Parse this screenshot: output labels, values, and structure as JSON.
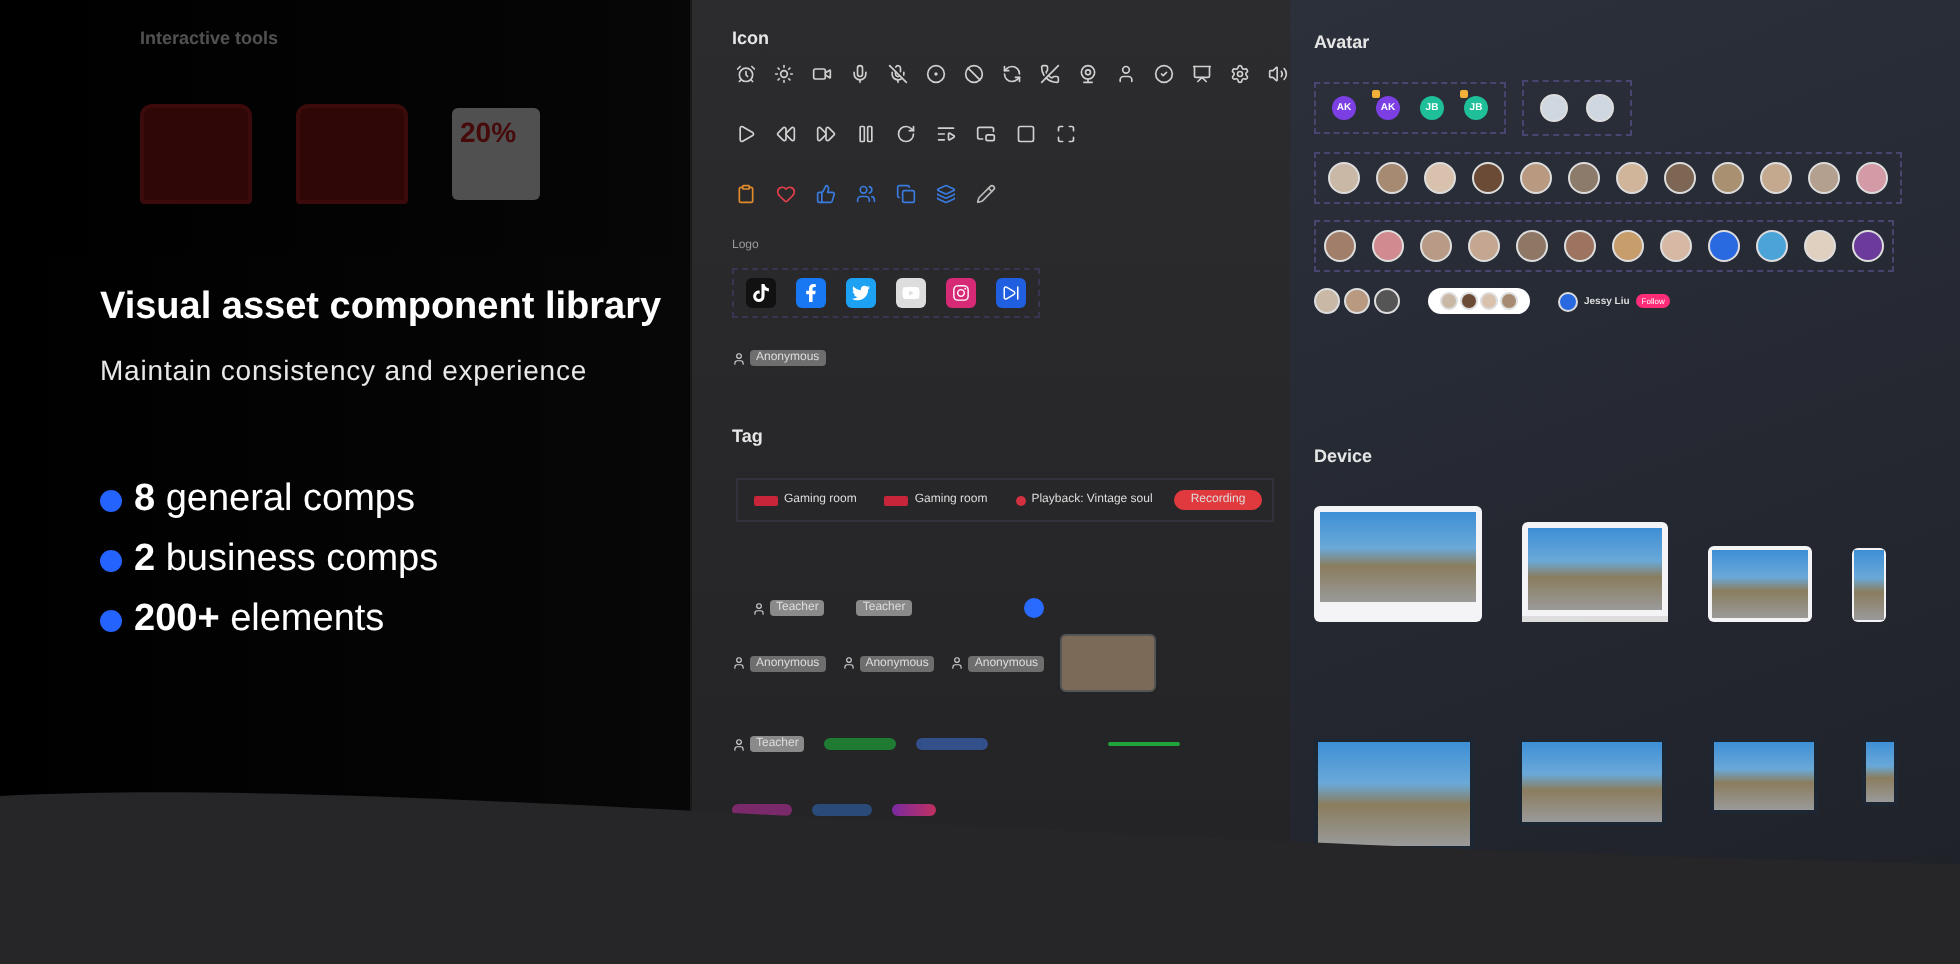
{
  "tools_panel": {
    "title": "Interactive tools",
    "coupon": "20%"
  },
  "hero": {
    "title": "Visual asset component library",
    "subtitle": "Maintain consistency and experience",
    "bullets": [
      {
        "count": "8",
        "label": "general comps"
      },
      {
        "count": "2",
        "label": "business comps"
      },
      {
        "count": "200+",
        "label": "elements"
      }
    ]
  },
  "icon_panel": {
    "title": "Icon",
    "logo_title": "Logo",
    "anonymous_tag": "Anonymous",
    "tag_title": "Tag",
    "stream_tags": [
      {
        "kind": "live",
        "text": "Gaming room"
      },
      {
        "kind": "live",
        "text": "Gaming room"
      },
      {
        "kind": "playback",
        "text": "Playback: Vintage soul"
      },
      {
        "kind": "recording",
        "text": "Recording"
      }
    ],
    "role_tags": [
      {
        "kind": "teacher",
        "text": "Teacher"
      },
      {
        "kind": "teacher_plain",
        "text": "Teacher"
      },
      {
        "kind": "anonymous",
        "text": "Anonymous"
      },
      {
        "kind": "anonymous",
        "text": "Anonymous"
      },
      {
        "kind": "anonymous",
        "text": "Anonymous"
      }
    ],
    "caller_tag": "Teacher"
  },
  "avatar_panel": {
    "title": "Avatar",
    "initials": [
      {
        "text": "AK",
        "color": "#7b3fe4",
        "hand_raised": false
      },
      {
        "text": "AK",
        "color": "#7b3fe4",
        "hand_raised": true
      },
      {
        "text": "JB",
        "color": "#1fbf9a",
        "hand_raised": false
      },
      {
        "text": "JB",
        "color": "#1fbf9a",
        "hand_raised": true
      }
    ],
    "profile": {
      "name": "Jessy Liu",
      "action": "Follow"
    }
  },
  "device_panel": {
    "title": "Device"
  }
}
